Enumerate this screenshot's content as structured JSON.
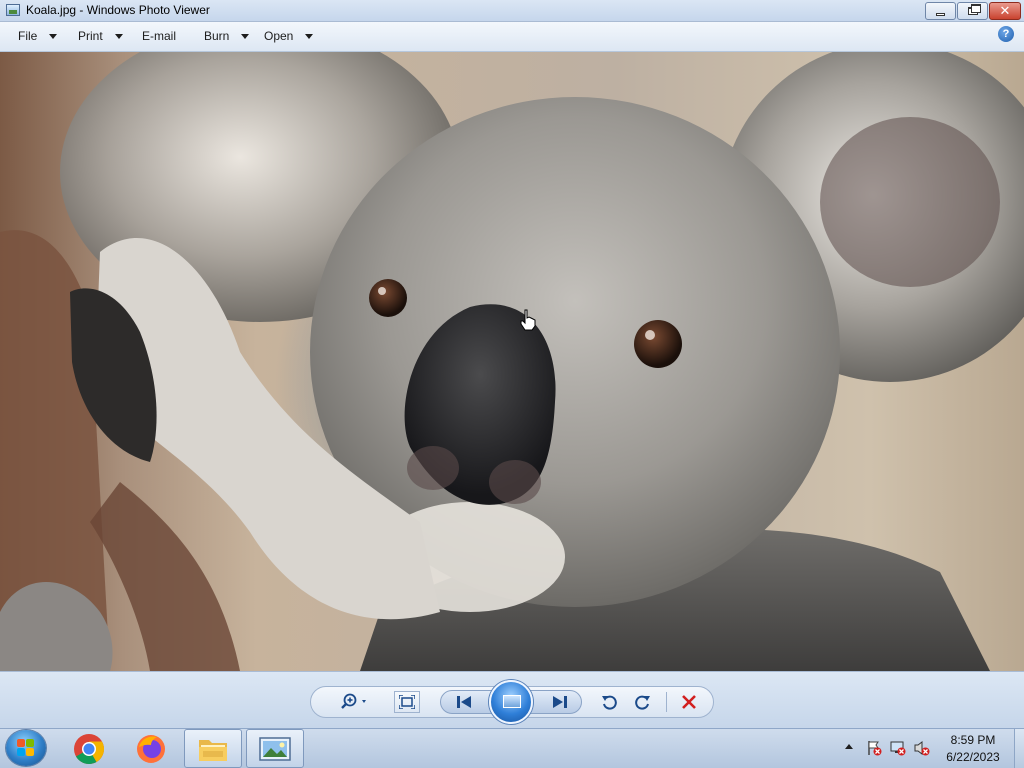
{
  "window": {
    "title": "Koala.jpg - Windows Photo Viewer"
  },
  "menu": {
    "items": [
      {
        "label": "File",
        "has_arrow": true
      },
      {
        "label": "Print",
        "has_arrow": true
      },
      {
        "label": "E-mail",
        "has_arrow": false
      },
      {
        "label": "Burn",
        "has_arrow": true
      },
      {
        "label": "Open",
        "has_arrow": true
      }
    ],
    "help_icon": "help-icon",
    "help_glyph": "?"
  },
  "photo": {
    "subject": "koala"
  },
  "controls": {
    "zoom_icon": "zoom-icon",
    "fit_icon": "actual-size-icon",
    "previous_icon": "previous-icon",
    "slideshow_icon": "slideshow-icon",
    "next_icon": "next-icon",
    "rotate_ccw_icon": "rotate-counterclockwise-icon",
    "rotate_cw_icon": "rotate-clockwise-icon",
    "delete_icon": "delete-icon"
  },
  "taskbar": {
    "apps": [
      {
        "name": "Google Chrome",
        "icon": "chrome-icon"
      },
      {
        "name": "Firefox",
        "icon": "firefox-icon"
      },
      {
        "name": "Windows Explorer",
        "icon": "folder-icon"
      },
      {
        "name": "Windows Photo Viewer",
        "icon": "photo-viewer-icon"
      }
    ],
    "tray_icons": [
      "action-center-icon",
      "network-icon",
      "volume-muted-icon"
    ],
    "clock": {
      "time": "8:59 PM",
      "date": "6/22/2023"
    }
  },
  "colors": {
    "delete": "#d21f1f",
    "accent": "#1b4a8a"
  }
}
